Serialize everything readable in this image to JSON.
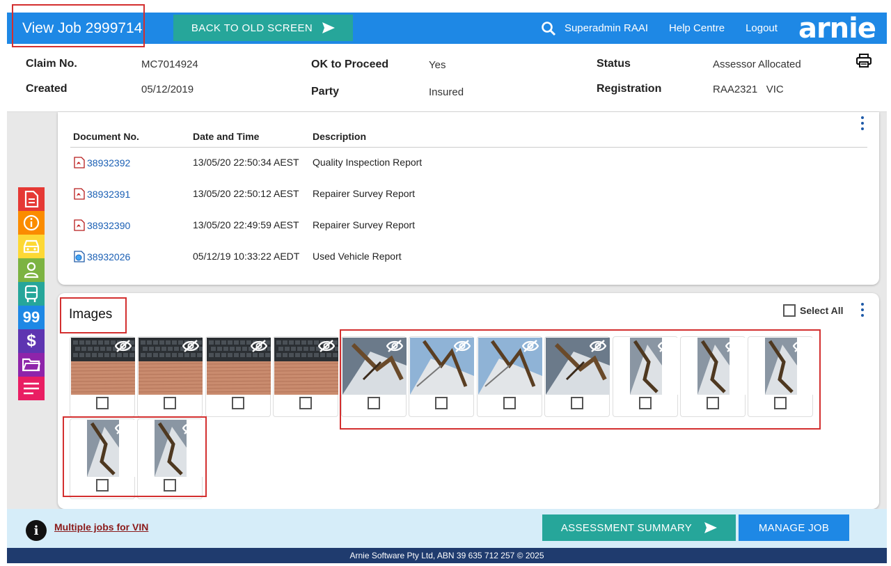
{
  "header": {
    "title": "View Job 2999714",
    "back_button": "BACK TO OLD SCREEN",
    "user": "Superadmin RAAI",
    "help": "Help Centre",
    "logout": "Logout",
    "logo": "arnie",
    "accent": "#1e88e5"
  },
  "claim": {
    "claim_no_label": "Claim No.",
    "claim_no": "MC7014924",
    "created_label": "Created",
    "created": "05/12/2019",
    "ok_label": "OK to Proceed",
    "ok": "Yes",
    "party_label": "Party",
    "party": "Insured",
    "status_label": "Status",
    "status": "Assessor Allocated",
    "rego_label": "Registration",
    "rego": "RAA2321   VIC"
  },
  "sidebar": {
    "icons": [
      {
        "name": "document-icon",
        "color": "#e53935"
      },
      {
        "name": "info-icon",
        "color": "#fb8c00"
      },
      {
        "name": "car-icon",
        "color": "#fdd835"
      },
      {
        "name": "person-icon",
        "color": "#7cb342"
      },
      {
        "name": "vehicle-front-icon",
        "color": "#26a69a"
      },
      {
        "name": "quote-icon",
        "color": "#1e88e5",
        "glyph": "99"
      },
      {
        "name": "dollar-icon",
        "color": "#5e35b1",
        "glyph": "$"
      },
      {
        "name": "folder-icon",
        "color": "#8e24aa"
      },
      {
        "name": "notes-icon",
        "color": "#e91e63"
      }
    ]
  },
  "documents": {
    "headers": {
      "no": "Document No.",
      "datetime": "Date and Time",
      "desc": "Description"
    },
    "rows": [
      {
        "no": "38932392",
        "datetime": "13/05/20 22:50:34 AEST",
        "desc": "Quality Inspection Report",
        "icon": "pdf-icon"
      },
      {
        "no": "38932391",
        "datetime": "13/05/20 22:50:12 AEST",
        "desc": "Repairer Survey Report",
        "icon": "pdf-icon"
      },
      {
        "no": "38932390",
        "datetime": "13/05/20 22:49:59 AEST",
        "desc": "Repairer Survey Report",
        "icon": "pdf-icon"
      },
      {
        "no": "38932026",
        "datetime": "05/12/19 10:33:22 AEDT",
        "desc": "Used Vehicle Report",
        "icon": "web-doc-icon"
      }
    ]
  },
  "images": {
    "title": "Images",
    "select_all": "Select All",
    "tiles": [
      {
        "kind": "keyboard"
      },
      {
        "kind": "keyboard"
      },
      {
        "kind": "keyboard"
      },
      {
        "kind": "keyboard"
      },
      {
        "kind": "damage"
      },
      {
        "kind": "damage-sky"
      },
      {
        "kind": "damage-sky"
      },
      {
        "kind": "damage"
      },
      {
        "kind": "portrait"
      },
      {
        "kind": "portrait"
      },
      {
        "kind": "portrait"
      },
      {
        "kind": "portrait"
      },
      {
        "kind": "portrait"
      }
    ]
  },
  "bottom": {
    "vin_link": "Multiple jobs for VIN",
    "assessment_button": "ASSESSMENT SUMMARY",
    "manage_button": "MANAGE JOB",
    "footer": "Arnie Software Pty Ltd, ABN 39 635 712 257 © 2025"
  }
}
